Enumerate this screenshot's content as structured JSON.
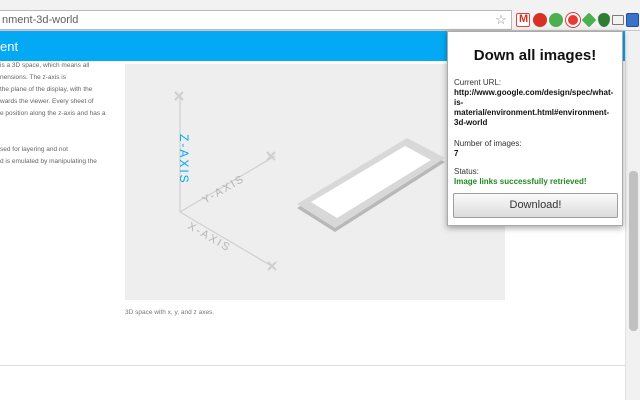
{
  "browser": {
    "url": "nment-3d-world"
  },
  "page": {
    "title": "ent",
    "article_lines": [
      "is a 3D space, which means all",
      "nensions. The z-axis is",
      "the plane of the display, with the",
      "wards the viewer. Every sheet of",
      "e position along the z-axis and has a",
      "",
      "sed for layering and not",
      "d is emulated by manipulating the"
    ],
    "figure": {
      "labels": [
        "Z-AXIS",
        "Y-AXIS",
        "X-AXIS"
      ],
      "caption": "3D space with x, y, and z axes."
    }
  },
  "popup": {
    "title": "Down all images!",
    "current_url_label": "Current URL:",
    "current_url_lines": [
      "http://www.google.com/design/spec/what-",
      "is-",
      "material/environment.html#environment-",
      "3d-world"
    ],
    "num_images_label": "Number of images:",
    "num_images_value": "7",
    "status_label": "Status:",
    "status_value": "Image links successfully retrieved!",
    "download_label": "Download!"
  },
  "colors": {
    "header": "#03a9f4",
    "status_ok": "#218a21",
    "z_axis": "#03a9f4"
  }
}
